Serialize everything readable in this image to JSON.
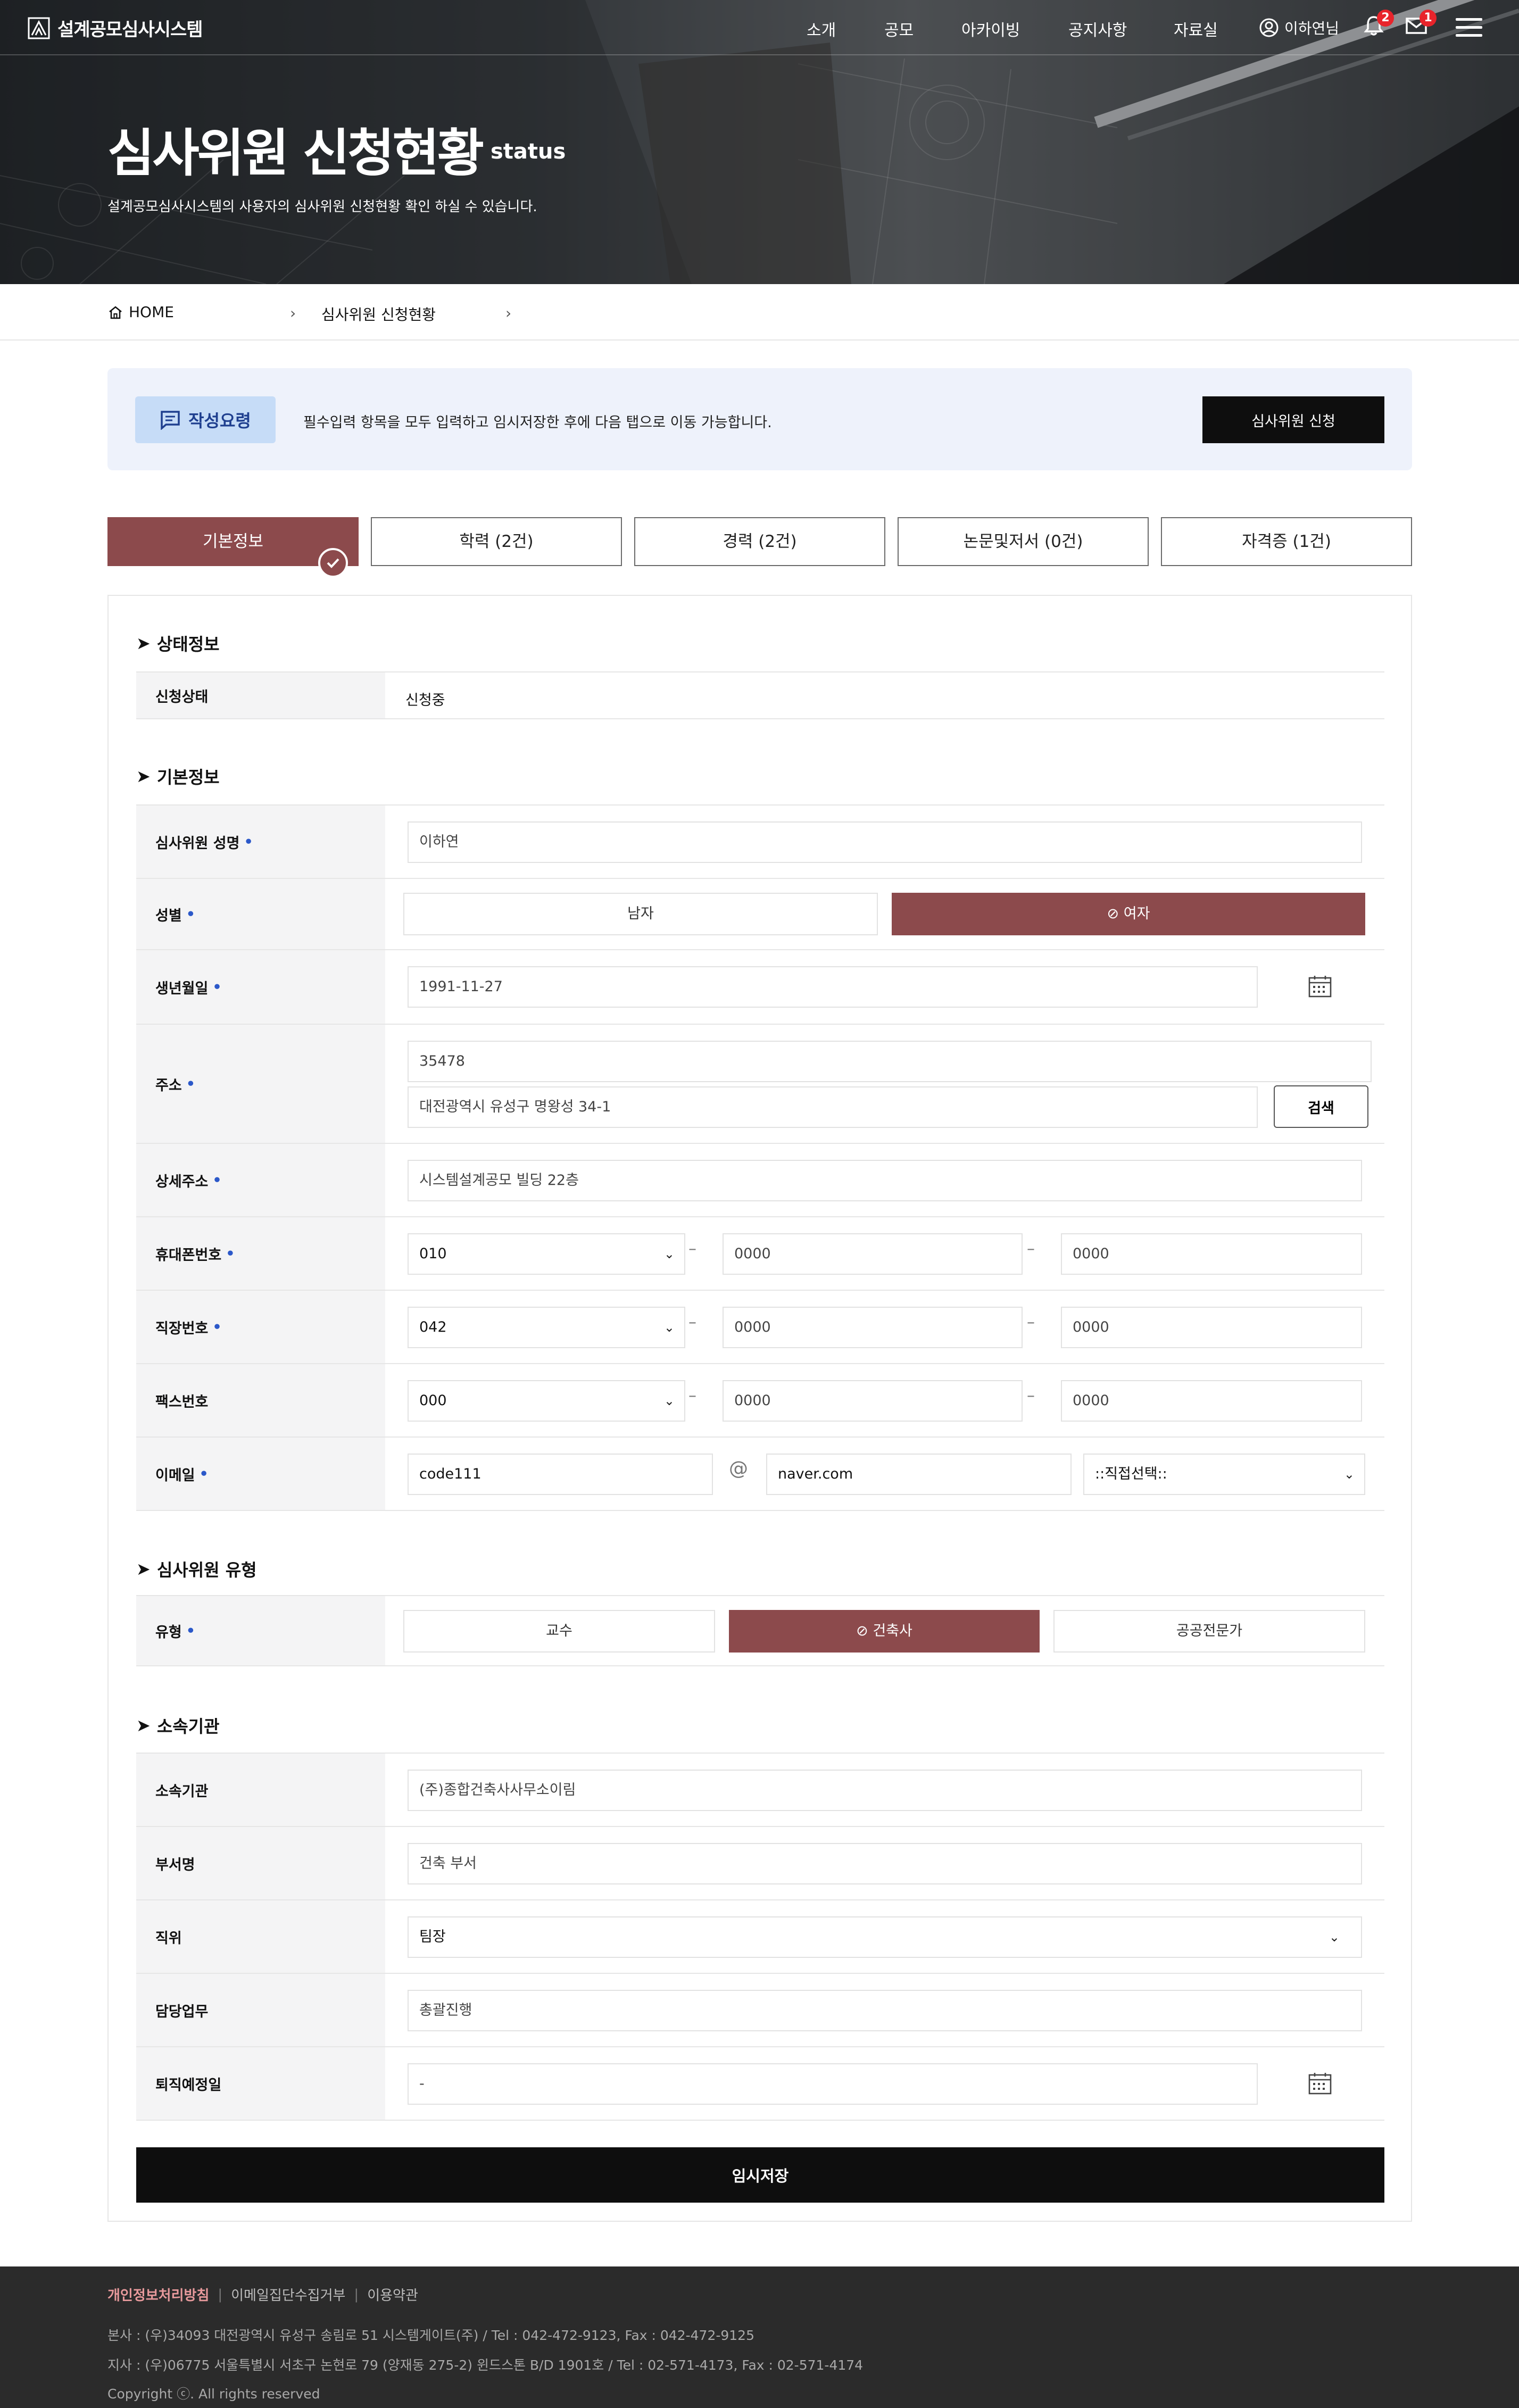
{
  "header": {
    "logo_text": "설계공모심사시스템",
    "menu": [
      "소개",
      "공모",
      "아카이빙",
      "공지사항",
      "자료실"
    ],
    "user_name": "이하연님",
    "notif_count": "2",
    "mail_count": "1"
  },
  "hero": {
    "title": "심사위원 신청현황",
    "subtitle": "status",
    "description": "설계공모심사시스템의 사용자의 심사위원 신청현황 확인 하실 수 있습니다."
  },
  "breadcrumb": {
    "home": "HOME",
    "current": "심사위원 신청현황"
  },
  "notice": {
    "tag": "작성요령",
    "text": "필수입력 항목을 모두 입력하고 임시저장한 후에 다음 탭으로 이동 가능합니다.",
    "apply_button": "심사위원 신청"
  },
  "tabs": [
    "기본정보",
    "학력 (2건)",
    "경력 (2건)",
    "논문및저서 (0건)",
    "자격증 (1건)"
  ],
  "status_section": {
    "title": "상태정보",
    "label": "신청상태",
    "value": "신청중"
  },
  "basic_section": {
    "title": "기본정보",
    "name_label": "심사위원 성명",
    "name_value": "이하연",
    "gender_label": "성별",
    "gender_male": "남자",
    "gender_female": "여자",
    "birth_label": "생년월일",
    "birth_value": "1991-11-27",
    "address_label": "주소",
    "zip_value": "35478",
    "address_value": "대전광역시 유성구 명왕성 34-1",
    "search_button": "검색",
    "detail_label": "상세주소",
    "detail_value": "시스템설계공모 빌딩 22층",
    "mobile_label": "휴대폰번호",
    "mobile": [
      "010",
      "0000",
      "0000"
    ],
    "work_label": "직장번호",
    "work": [
      "042",
      "0000",
      "0000"
    ],
    "fax_label": "팩스번호",
    "fax": [
      "000",
      "0000",
      "0000"
    ],
    "email_label": "이메일",
    "email_id": "code111",
    "email_at": "@",
    "email_domain": "naver.com",
    "email_select": "::직접선택::",
    "dash": "–"
  },
  "type_section": {
    "title": "심사위원 유형",
    "label": "유형",
    "options": [
      "교수",
      "건축사",
      "공공전문가"
    ]
  },
  "org_section": {
    "title": "소속기관",
    "org_label": "소속기관",
    "org_value": "(주)종합건축사사무소이림",
    "dept_label": "부서명",
    "dept_value": "건축 부서",
    "position_label": "직위",
    "position_value": "팀장",
    "duty_label": "담당업무",
    "duty_value": "총괄진행",
    "retire_label": "퇴직예정일",
    "retire_value": "-"
  },
  "save_button": "임시저장",
  "footer": {
    "links": [
      "개인정보처리방침",
      "이메일집단수집거부",
      "이용약관"
    ],
    "sep": "|",
    "hq": "본사 : (우)34093 대전광역시 유성구 송림로 51 시스템게이트(주) / Tel : 042-472-9123, Fax : 042-472-9125",
    "branch": "지사 : (우)06775 서울특별시 서초구 논현로 79 (양재동 275-2) 윈드스톤 B/D 1901호 / Tel : 02-571-4173, Fax : 02-571-4174",
    "copyright": "Copyright ⓒ. All rights reserved"
  },
  "colors": {
    "accent": "#8c4a4c",
    "dark": "#0e0e0e",
    "notice_bg": "#eef2fb",
    "tag_bg": "#c6dcf7",
    "required": "#2b58c9"
  }
}
